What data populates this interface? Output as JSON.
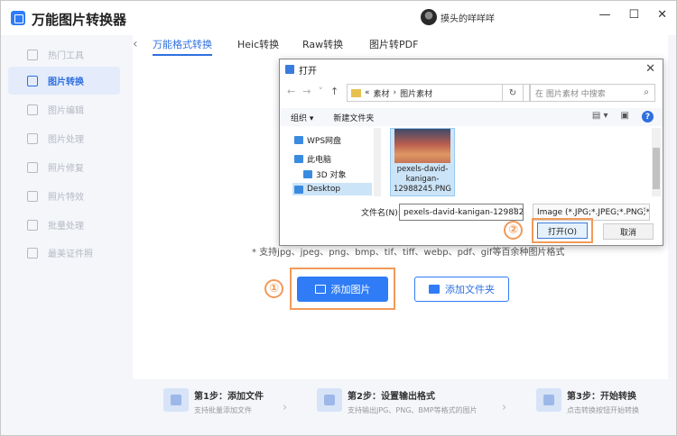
{
  "app": {
    "title": "万能图片转换器",
    "username": "摸头的咩咩咩",
    "win_min": "—",
    "win_max": "☐",
    "win_close": "✕"
  },
  "sidebar": {
    "items": [
      {
        "label": "热门工具"
      },
      {
        "label": "图片转换"
      },
      {
        "label": "图片编辑"
      },
      {
        "label": "图片处理"
      },
      {
        "label": "照片修复"
      },
      {
        "label": "照片特效"
      },
      {
        "label": "批量处理"
      },
      {
        "label": "最美证件照"
      }
    ]
  },
  "tabs": [
    {
      "label": "万能格式转换"
    },
    {
      "label": "Heic转换"
    },
    {
      "label": "Raw转换"
    },
    {
      "label": "图片转PDF"
    }
  ],
  "main": {
    "formats_text": "* 支持jpg、jpeg、png、bmp、tif、tiff、webp、pdf、gif等百余种图片格式",
    "add_image": "添加图片",
    "add_folder": "添加文件夹",
    "badge1": "①",
    "badge2": "②"
  },
  "steps": [
    {
      "title": "第1步：添加文件",
      "desc": "支持批量添加文件"
    },
    {
      "title": "第2步：设置输出格式",
      "desc": "支持输出JPG、PNG、BMP等格式的图片"
    },
    {
      "title": "第3步：开始转换",
      "desc": "点击转换按钮开始转换"
    }
  ],
  "dialog": {
    "title": "打开",
    "breadcrumb_prefix": "«",
    "breadcrumb_1": "素材",
    "breadcrumb_sep": "›",
    "breadcrumb_2": "图片素材",
    "search_placeholder": "在 图片素材 中搜索",
    "organize": "组织 ▾",
    "new_folder": "新建文件夹",
    "nav_items": [
      {
        "label": "WPS网盘"
      },
      {
        "label": "此电脑"
      },
      {
        "label": "3D 对象"
      },
      {
        "label": "Desktop"
      }
    ],
    "file_name": "pexels-david-kanigan-12988245.PNG",
    "file_name_label": "文件名(N):",
    "file_name_value": "pexels-david-kanigan-1298824",
    "filter": "Image (*.JPG;*.JPEG;*.PNG;*.I",
    "open_btn": "打开(O)",
    "cancel_btn": "取消"
  }
}
